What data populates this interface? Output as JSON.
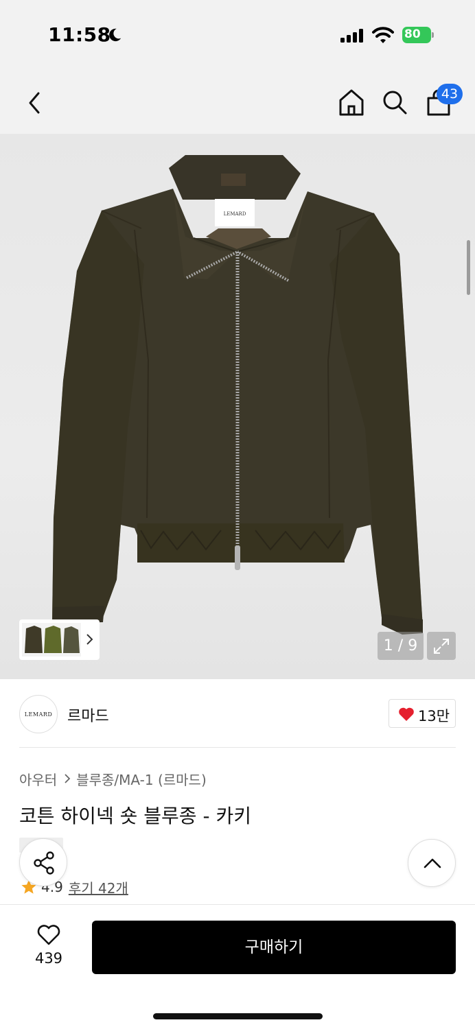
{
  "status_bar": {
    "time": "11:58",
    "battery": "80",
    "icons": [
      "moon-icon",
      "signal-icon",
      "wifi-icon",
      "battery-icon"
    ]
  },
  "nav": {
    "icons": [
      "back-icon",
      "home-icon",
      "search-icon",
      "bag-icon"
    ],
    "cart_count": "43"
  },
  "gallery": {
    "image_subject": "khaki cotton zip jacket",
    "label_text": "LEMARD",
    "counter": "1 / 9",
    "colors": {
      "jacket": "#3f3a2b",
      "background": "#e8e8e8"
    }
  },
  "brand": {
    "logo_text": "LEMARD",
    "name": "르마드",
    "likes": "13만"
  },
  "breadcrumb": {
    "category": "아우터",
    "subcategory": "블루종/MA-1 (르마드)"
  },
  "product": {
    "title": "코튼 하이넥 숏 블루종 - 카키",
    "rating": "4.9",
    "reviews": "후기 42개"
  },
  "bottom_bar": {
    "wish_count": "439",
    "buy_label": "구매하기",
    "colors": {
      "buy_button": "#000000",
      "heart": "#e5202e",
      "star": "#f5a623",
      "badge": "#1f6feb"
    }
  }
}
